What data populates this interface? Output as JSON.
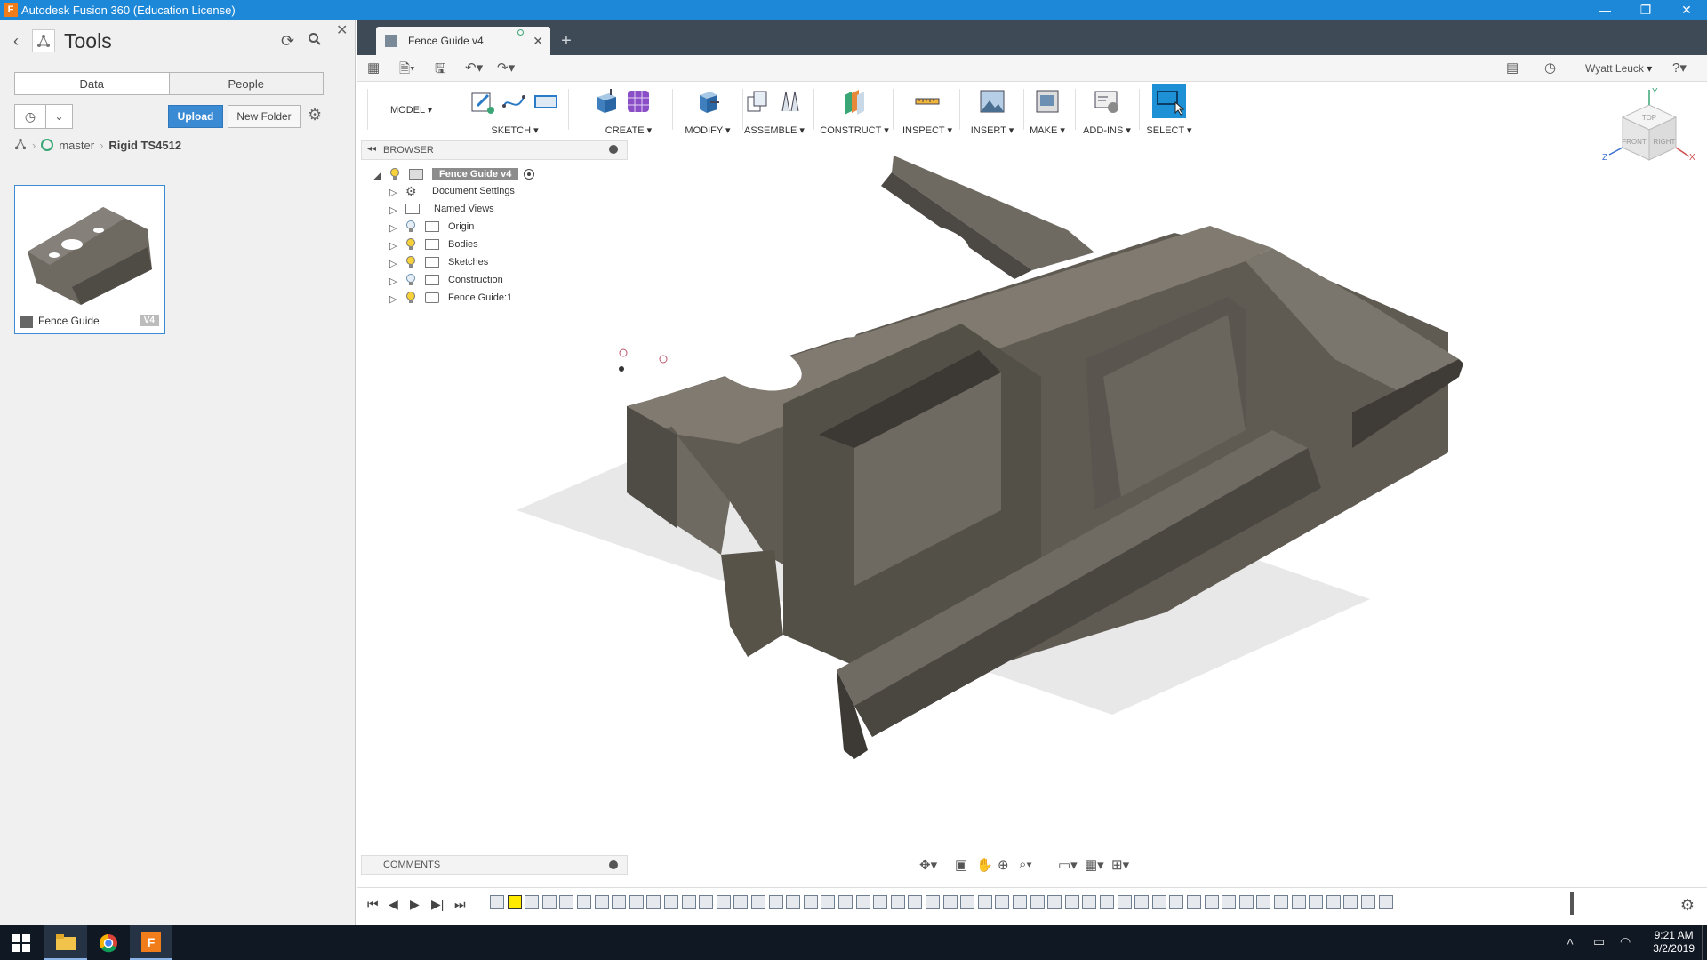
{
  "window": {
    "title": "Autodesk Fusion 360 (Education License)",
    "app_icon_letter": "F",
    "minimize": "—",
    "restore": "❐",
    "close": "✕"
  },
  "data_panel": {
    "project_title": "Tools",
    "tabs": [
      {
        "label": "Data",
        "active": true
      },
      {
        "label": "People",
        "active": false
      }
    ],
    "upload_label": "Upload",
    "new_folder_label": "New Folder",
    "breadcrumb": {
      "branch": "master",
      "folder": "Rigid TS4512"
    },
    "file_card": {
      "name": "Fence Guide",
      "version": "V4"
    }
  },
  "document_tab": {
    "label": "Fence Guide v4"
  },
  "quick_access": {
    "user": "Wyatt Leuck"
  },
  "toolbar": {
    "workspace": "MODEL",
    "groups": [
      {
        "label": "SKETCH"
      },
      {
        "label": "CREATE"
      },
      {
        "label": "MODIFY"
      },
      {
        "label": "ASSEMBLE"
      },
      {
        "label": "CONSTRUCT"
      },
      {
        "label": "INSPECT"
      },
      {
        "label": "INSERT"
      },
      {
        "label": "MAKE"
      },
      {
        "label": "ADD-INS"
      },
      {
        "label": "SELECT"
      }
    ]
  },
  "browser": {
    "title": "BROWSER",
    "root": "Fence Guide v4",
    "items": [
      {
        "label": "Document Settings",
        "icon": "gear-icon"
      },
      {
        "label": "Named Views",
        "icon": "folder-icon"
      },
      {
        "label": "Origin",
        "icon": "folder-icon",
        "visible": false
      },
      {
        "label": "Bodies",
        "icon": "folder-icon",
        "visible": true
      },
      {
        "label": "Sketches",
        "icon": "folder-icon",
        "visible": true
      },
      {
        "label": "Construction",
        "icon": "folder-icon",
        "visible": false
      },
      {
        "label": "Fence Guide:1",
        "icon": "component-icon",
        "visible": true
      }
    ]
  },
  "comments": {
    "title": "COMMENTS"
  },
  "viewcube": {
    "top": "TOP",
    "front": "FRONT",
    "right": "RIGHT",
    "axis_x": "X",
    "axis_y": "Y",
    "axis_z": "Z"
  },
  "taskbar": {
    "time": "9:21 AM",
    "date": "3/2/2019"
  },
  "colors": {
    "titlebar": "#1e88d8",
    "tabbar": "#3e4a56",
    "upload": "#3b8ad4",
    "model_face": "#5f5a52",
    "select_active": "#1e90d6"
  }
}
